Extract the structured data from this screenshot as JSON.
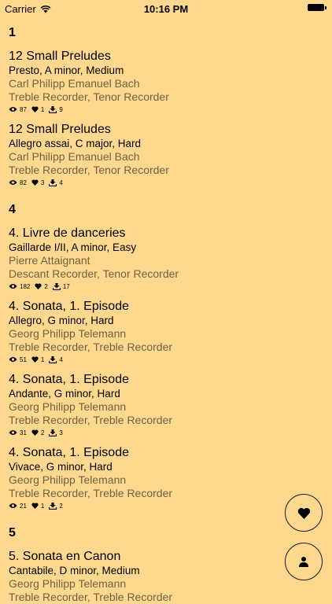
{
  "status": {
    "carrier": "Carrier",
    "time": "10:16 PM"
  },
  "sections": [
    {
      "header": "1",
      "items": [
        {
          "title": "12 Small Preludes",
          "subtitle": "Presto, A minor, Medium",
          "composer": "Carl Philipp Emanuel Bach",
          "instruments": "Treble Recorder, Tenor Recorder",
          "views": "87",
          "likes": "1",
          "downloads": "9"
        },
        {
          "title": "12 Small Preludes",
          "subtitle": "Allegro assai, C major, Hard",
          "composer": "Carl Philipp Emanuel Bach",
          "instruments": "Treble Recorder, Tenor Recorder",
          "views": "82",
          "likes": "3",
          "downloads": "4"
        }
      ]
    },
    {
      "header": "4",
      "items": [
        {
          "title": "4. Livre de danceries",
          "subtitle": "Gaillarde I/II, A minor, Easy",
          "composer": "Pierre Attaignant",
          "instruments": "Descant Recorder, Tenor Recorder",
          "views": "182",
          "likes": "2",
          "downloads": "17"
        },
        {
          "title": "4. Sonata, 1. Episode",
          "subtitle": "Allegro, G minor, Hard",
          "composer": "Georg Philipp Telemann",
          "instruments": "Treble Recorder, Treble Recorder",
          "views": "51",
          "likes": "1",
          "downloads": "4"
        },
        {
          "title": "4. Sonata, 1. Episode",
          "subtitle": "Andante, G minor, Hard",
          "composer": "Georg Philipp Telemann",
          "instruments": "Treble Recorder, Treble Recorder",
          "views": "31",
          "likes": "2",
          "downloads": "3"
        },
        {
          "title": "4. Sonata, 1. Episode",
          "subtitle": "Vivace, G minor, Hard",
          "composer": "Georg Philipp Telemann",
          "instruments": "Treble Recorder, Treble Recorder",
          "views": "21",
          "likes": "1",
          "downloads": "2"
        }
      ]
    },
    {
      "header": "5",
      "items": [
        {
          "title": "5. Sonata en Canon",
          "subtitle": "Cantabile, D minor, Medium",
          "composer": "Georg Philipp Telemann",
          "instruments": "Treble Recorder, Treble Recorder"
        }
      ]
    }
  ],
  "icons": {
    "views": "eye-icon",
    "likes": "heart-icon",
    "downloads": "download-icon",
    "favorites_button": "heart-icon",
    "profile_button": "person-icon"
  },
  "colors": {
    "background": "#ffd88f",
    "secondary_text": "#6f6141"
  }
}
